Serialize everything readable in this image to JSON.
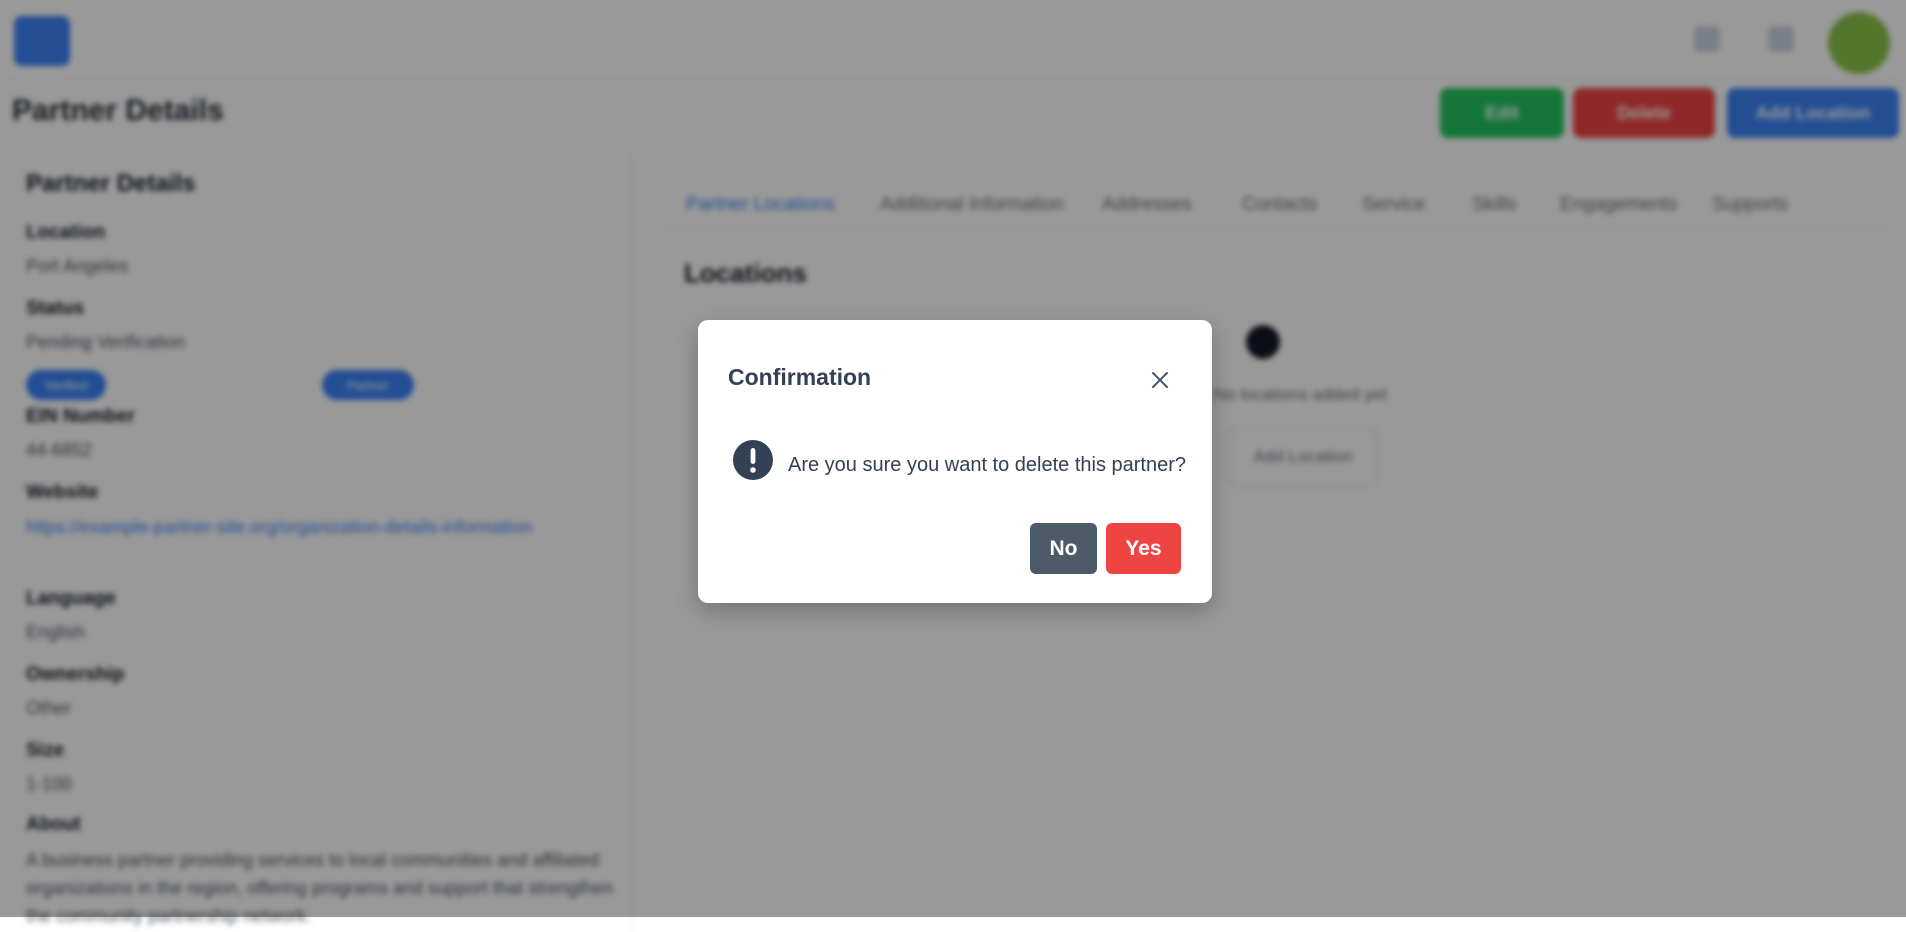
{
  "header": {
    "page_title": "Partner Details"
  },
  "actions": {
    "edit_label": "Edit",
    "delete_label": "Delete",
    "primary_label": "Add Location"
  },
  "sidebar_details": {
    "title": "Partner Details",
    "fields": [
      {
        "label": "Location",
        "value": "Port Angeles"
      },
      {
        "label": "Status",
        "value": "Pending Verification"
      },
      {
        "label": "EIN Number",
        "value": "44-6852"
      },
      {
        "label": "Website",
        "value": "https://example-partner-site.org/organization-details-information"
      },
      {
        "label": "Language",
        "value": "English"
      },
      {
        "label": "Ownership",
        "value": "Other"
      },
      {
        "label": "Size",
        "value": "1-100"
      }
    ],
    "badges": [
      "Verified",
      "Partner"
    ],
    "about_label": "About",
    "about_text": "A business partner providing services to local communities and affiliated organizations in the region, offering programs and support that strengthen the community partnership network."
  },
  "tabs": [
    "Partner Locations",
    "Additional Information",
    "Addresses",
    "Contacts",
    "Service",
    "Skills",
    "Engagements",
    "Supports"
  ],
  "location_section": {
    "title": "Locations",
    "empty_text": "No locations added yet",
    "add_button": "Add Location"
  },
  "dialog": {
    "title": "Confirmation",
    "message": "Are you sure you want to delete this partner?",
    "no_label": "No",
    "yes_label": "Yes"
  },
  "colors": {
    "primary": "#3b82f6",
    "danger": "#ef4444",
    "success": "#22c55e",
    "secondary": "#4b5968",
    "icon": "#334155"
  }
}
